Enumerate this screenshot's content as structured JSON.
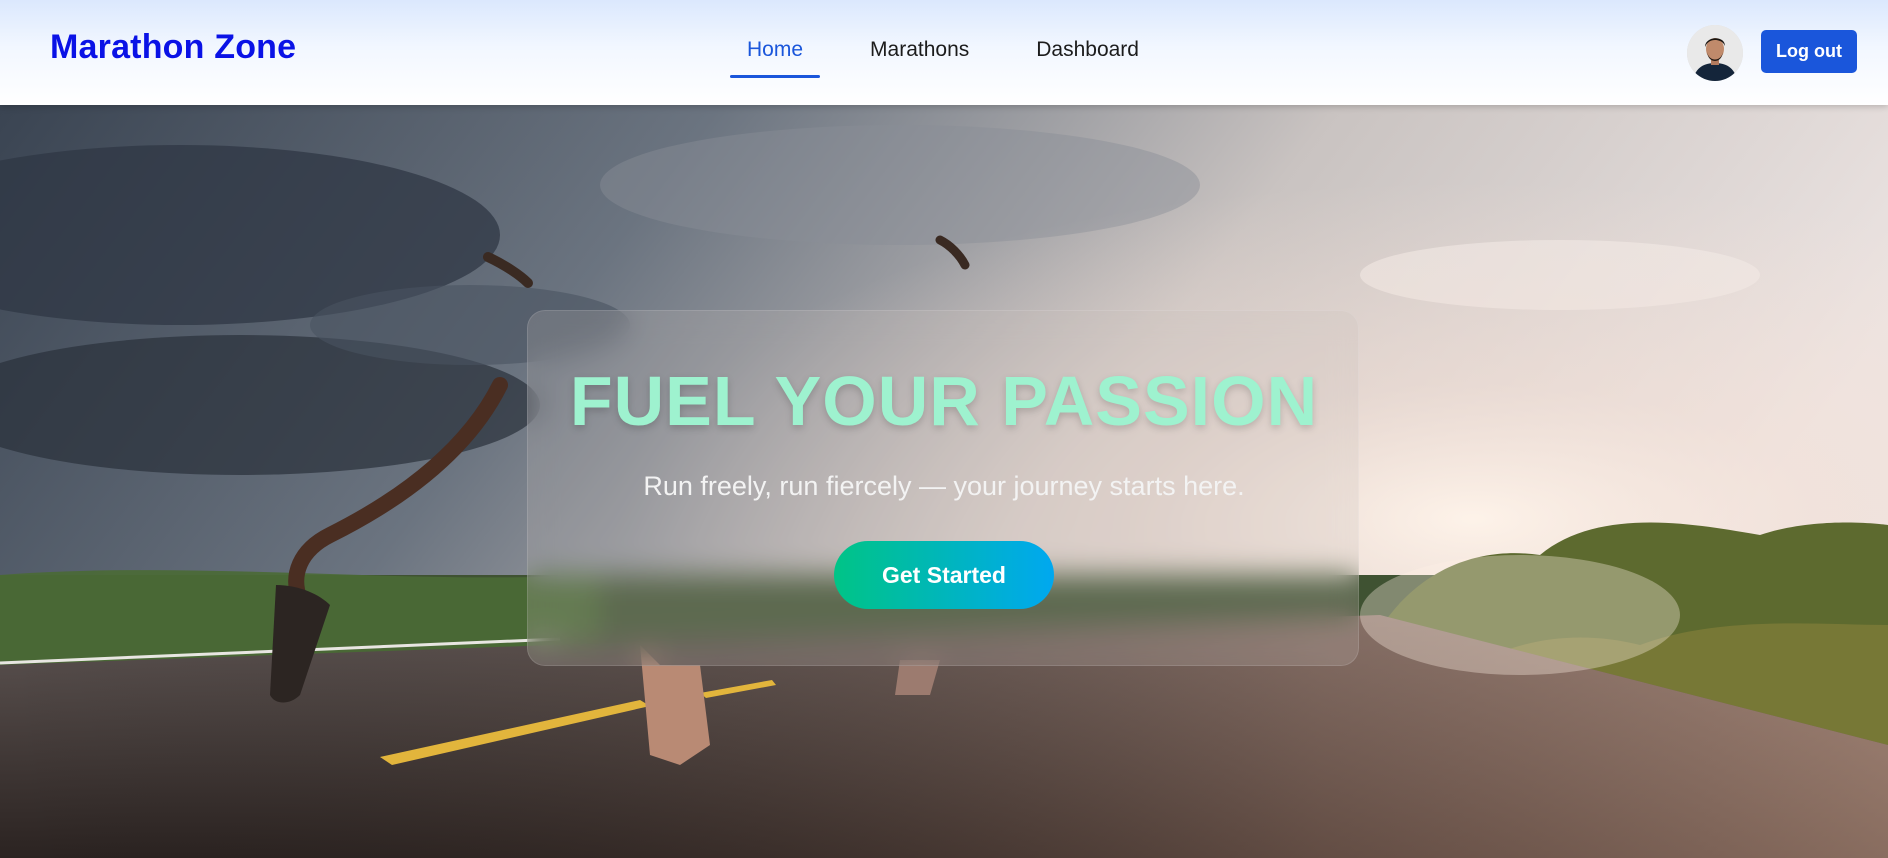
{
  "navbar": {
    "brand": "Marathon Zone",
    "links": [
      {
        "label": "Home",
        "active": true
      },
      {
        "label": "Marathons",
        "active": false
      },
      {
        "label": "Dashboard",
        "active": false
      }
    ],
    "logout_label": "Log out",
    "accent_color": "#1a56db",
    "brand_color": "#0a12e6"
  },
  "hero": {
    "headline": "FUEL YOUR PASSION",
    "subtitle": "Run freely, run fiercely — your journey starts here.",
    "cta_label": "Get Started",
    "headline_color": "#9ef2cf",
    "cta_gradient": [
      "#00c486",
      "#00a8f0"
    ]
  }
}
